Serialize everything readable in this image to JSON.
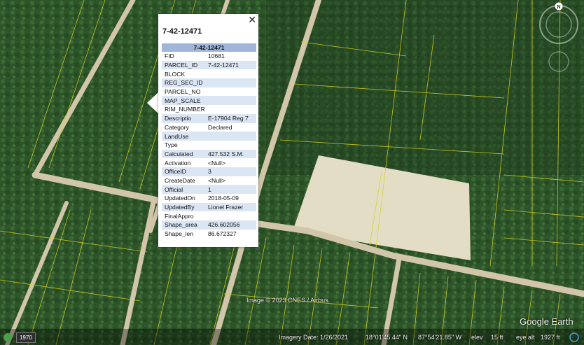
{
  "map": {
    "credit": "Image © 2023 CNES / Airbus",
    "logo": "Google Earth"
  },
  "popup": {
    "title": "7-42-12471",
    "header": "7-42-12471",
    "close_icon": "close-icon",
    "rows": [
      {
        "key": "FID",
        "value": "10681"
      },
      {
        "key": "PARCEL_ID",
        "value": "7-42-12471"
      },
      {
        "key": "BLOCK",
        "value": ""
      },
      {
        "key": "REG_SEC_ID",
        "value": ""
      },
      {
        "key": "PARCEL_NO",
        "value": ""
      },
      {
        "key": "MAP_SCALE",
        "value": ""
      },
      {
        "key": "RIM_NUMBER",
        "value": ""
      },
      {
        "key": "Descriptio",
        "value": "E-17904 Reg 7"
      },
      {
        "key": "Category",
        "value": "Declared"
      },
      {
        "key": "LandUse",
        "value": ""
      },
      {
        "key": "Type",
        "value": ""
      },
      {
        "key": "Calculated",
        "value": "427.532 S.M."
      },
      {
        "key": "Activation",
        "value": "<Null>"
      },
      {
        "key": "OfficeID",
        "value": "3"
      },
      {
        "key": "CreateDate",
        "value": "<Null>"
      },
      {
        "key": "Official",
        "value": "1"
      },
      {
        "key": "UpdatedOn",
        "value": "2018-05-09"
      },
      {
        "key": "UpdatedBy",
        "value": "Lionel Frazer"
      },
      {
        "key": "FinalAppro",
        "value": ""
      },
      {
        "key": "Shape_area",
        "value": "426.602056"
      },
      {
        "key": "Shape_len",
        "value": "86.672327"
      }
    ]
  },
  "status": {
    "year": "1970",
    "imagery_date": "Imagery Date: 1/26/2021",
    "lat": "18°01'45.44\" N",
    "lon": "87°54'21.85\" W",
    "elev_label": "elev",
    "elev_value": "15 ft",
    "eye_label": "eye alt",
    "eye_value": "1927 ft"
  },
  "navigation": {
    "north_label": "N"
  },
  "colors": {
    "parcel_line": "#d9d21e",
    "road": "#d8cdb4",
    "vegetation": "#2f5a2c",
    "clearing": "#e6e0cb",
    "header_bg": "#9fb6da"
  }
}
